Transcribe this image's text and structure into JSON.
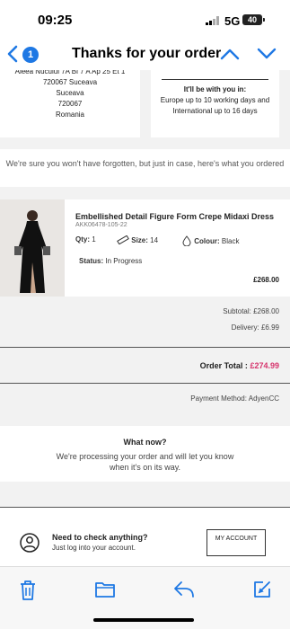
{
  "status_bar": {
    "time": "09:25",
    "network": "5G",
    "battery": "40"
  },
  "nav": {
    "title": "Thanks for your order",
    "unread_count": "1"
  },
  "address": {
    "lines": [
      "Aleea Nucului 7A Bl 7 A Ap 25 Et 1",
      "720067 Suceava",
      "Suceava",
      "720067",
      "Romania"
    ]
  },
  "delivery": {
    "heading": "It'll be with you in:",
    "body": "Europe up to 10 working days and International up to 16 days"
  },
  "reminder": "We're sure you won't have forgotten, but just in case, here's what you ordered",
  "item": {
    "name": "Embellished Detail Figure Form Crepe Midaxi Dress",
    "sku": "AKK06478-105-22",
    "qty_label": "Qty:",
    "qty": "1",
    "size_label": "Size:",
    "size": "14",
    "colour_label": "Colour:",
    "colour": "Black",
    "status_label": "Status:",
    "status": "In Progress",
    "price": "£268.00"
  },
  "totals": {
    "subtotal": "Subtotal: £268.00",
    "delivery": "Delivery: £6.99",
    "order_total_label": "Order Total :",
    "order_total": "£274.99",
    "payment_method": "Payment Method: AdyenCC"
  },
  "what_now": {
    "heading": "What now?",
    "body": "We're processing your order and will let you know when it's on its way."
  },
  "help": {
    "heading": "Need to check anything?",
    "body": "Just log into your account.",
    "button_label": "MY ACCOUNT"
  },
  "colors": {
    "accent": "#1e78e4",
    "order_total": "#d6336c"
  },
  "toolbar": {
    "icons": [
      "trash-icon",
      "folder-icon",
      "reply-icon",
      "compose-icon"
    ]
  }
}
